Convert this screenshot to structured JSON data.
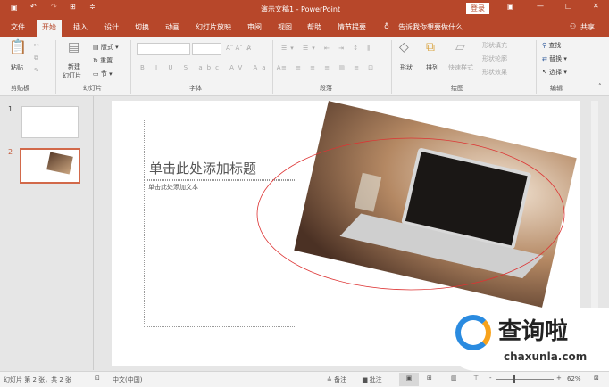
{
  "titlebar": {
    "title": "演示文稿1 - PowerPoint",
    "login": "登录",
    "save_icon": "save-icon",
    "undo_icon": "undo-icon",
    "redo_icon": "redo-icon"
  },
  "tabs": [
    "文件",
    "开始",
    "插入",
    "设计",
    "切换",
    "动画",
    "幻灯片放映",
    "审阅",
    "视图",
    "帮助",
    "情节提要"
  ],
  "tell_me": "告诉我你想要做什么",
  "share": "共享",
  "ribbon": {
    "clipboard": {
      "paste": "粘贴",
      "label": "剪贴板"
    },
    "slides": {
      "new_slide": "新建",
      "new_slide2": "幻灯片",
      "layout": "版式",
      "reset": "重置",
      "section": "节",
      "label": "幻灯片"
    },
    "font": {
      "label": "字体"
    },
    "paragraph": {
      "label": "段落"
    },
    "drawing": {
      "shape": "形状",
      "arrange": "排列",
      "quick_styles": "快速样式",
      "fill": "形状填充",
      "outline": "形状轮廓",
      "effects": "形状效果",
      "label": "绘图"
    },
    "editing": {
      "find": "查找",
      "replace": "替换",
      "select": "选择",
      "label": "编辑"
    }
  },
  "thumbnails": [
    {
      "num": "1"
    },
    {
      "num": "2"
    }
  ],
  "slide": {
    "title_placeholder": "单击此处添加标题",
    "text_placeholder": "单击此处添加文本"
  },
  "watermark": {
    "name": "查询啦",
    "url": "chaxunla.com"
  },
  "status": {
    "slide_info": "幻灯片 第 2 张，共 2 张",
    "language": "中文(中国)",
    "notes": "备注",
    "comments": "批注",
    "zoom": "62%"
  }
}
